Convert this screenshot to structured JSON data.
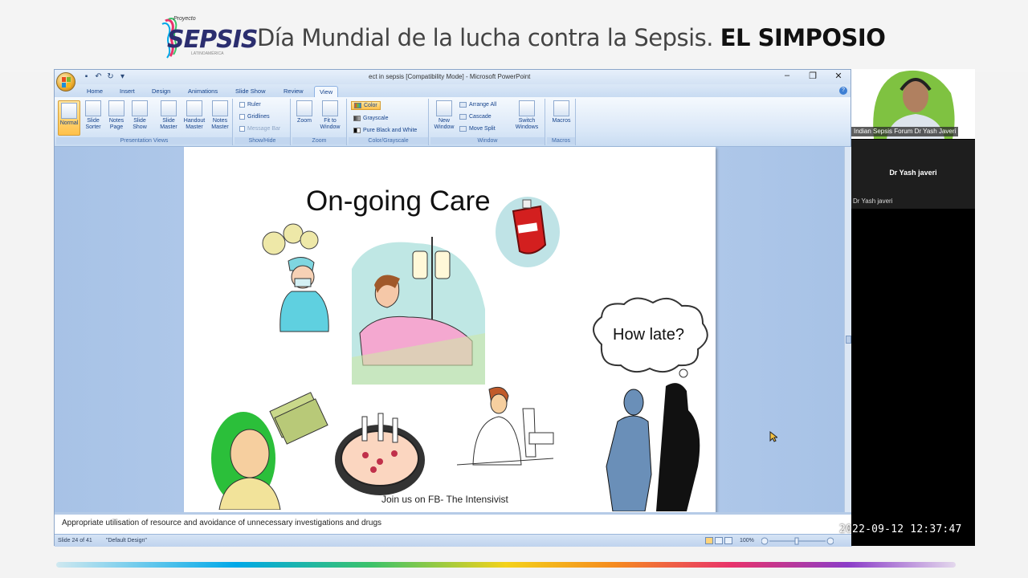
{
  "banner": {
    "logo_small": "Proyecto",
    "logo_word": "SEPSIS",
    "logo_tag": "LATINOAMÉRICA",
    "title_regular": "Día Mundial de la lucha contra la Sepsis.",
    "title_bold": "EL SIMPOSIO"
  },
  "window": {
    "title": "ect in sepsis [Compatibility Mode] - Microsoft PowerPoint",
    "controls": [
      "minimize-icon",
      "restore-icon",
      "close-icon"
    ]
  },
  "tabs": [
    "Home",
    "Insert",
    "Design",
    "Animations",
    "Slide Show",
    "Review",
    "View"
  ],
  "active_tab": "View",
  "ribbon": {
    "presentation_views": {
      "label": "Presentation Views",
      "buttons": [
        {
          "l1": "Normal",
          "l2": ""
        },
        {
          "l1": "Slide",
          "l2": "Sorter"
        },
        {
          "l1": "Notes",
          "l2": "Page"
        },
        {
          "l1": "Slide",
          "l2": "Show"
        },
        {
          "l1": "Slide",
          "l2": "Master"
        },
        {
          "l1": "Handout",
          "l2": "Master"
        },
        {
          "l1": "Notes",
          "l2": "Master"
        }
      ]
    },
    "show_hide": {
      "label": "Show/Hide",
      "items": [
        "Ruler",
        "Gridlines",
        "Message Bar"
      ]
    },
    "zoom": {
      "label": "Zoom",
      "buttons": [
        {
          "l1": "Zoom",
          "l2": ""
        },
        {
          "l1": "Fit to",
          "l2": "Window"
        }
      ]
    },
    "color": {
      "label": "Color/Grayscale",
      "items": [
        "Color",
        "Grayscale",
        "Pure Black and White"
      ]
    },
    "window_group": {
      "label": "Window",
      "new_window": {
        "l1": "New",
        "l2": "Window"
      },
      "items": [
        "Arrange All",
        "Cascade",
        "Move Split"
      ],
      "switch": {
        "l1": "Switch",
        "l2": "Windows"
      }
    },
    "macros": {
      "label": "Macros",
      "button": "Macros"
    }
  },
  "slide": {
    "title": "On-going Care",
    "bubble_text": "How late?",
    "footer": "Join us on FB- The Intensivist"
  },
  "notes": "Appropriate utilisation of resource and avoidance of unnecessary investigations and drugs",
  "status": {
    "slide_count": "Slide 24 of 41",
    "design": "\"Default Design\"",
    "zoom": "100%",
    "colors": {
      "accent": "#ffc14a",
      "ribbon": "#d9e7f7"
    }
  },
  "video": {
    "speaker_label": "Indian Sepsis Forum Dr Yash Javeri",
    "participant_name": "Dr Yash javeri",
    "participant_label": "Dr Yash javeri"
  },
  "timestamp": "2022-09-12 12:37:47"
}
